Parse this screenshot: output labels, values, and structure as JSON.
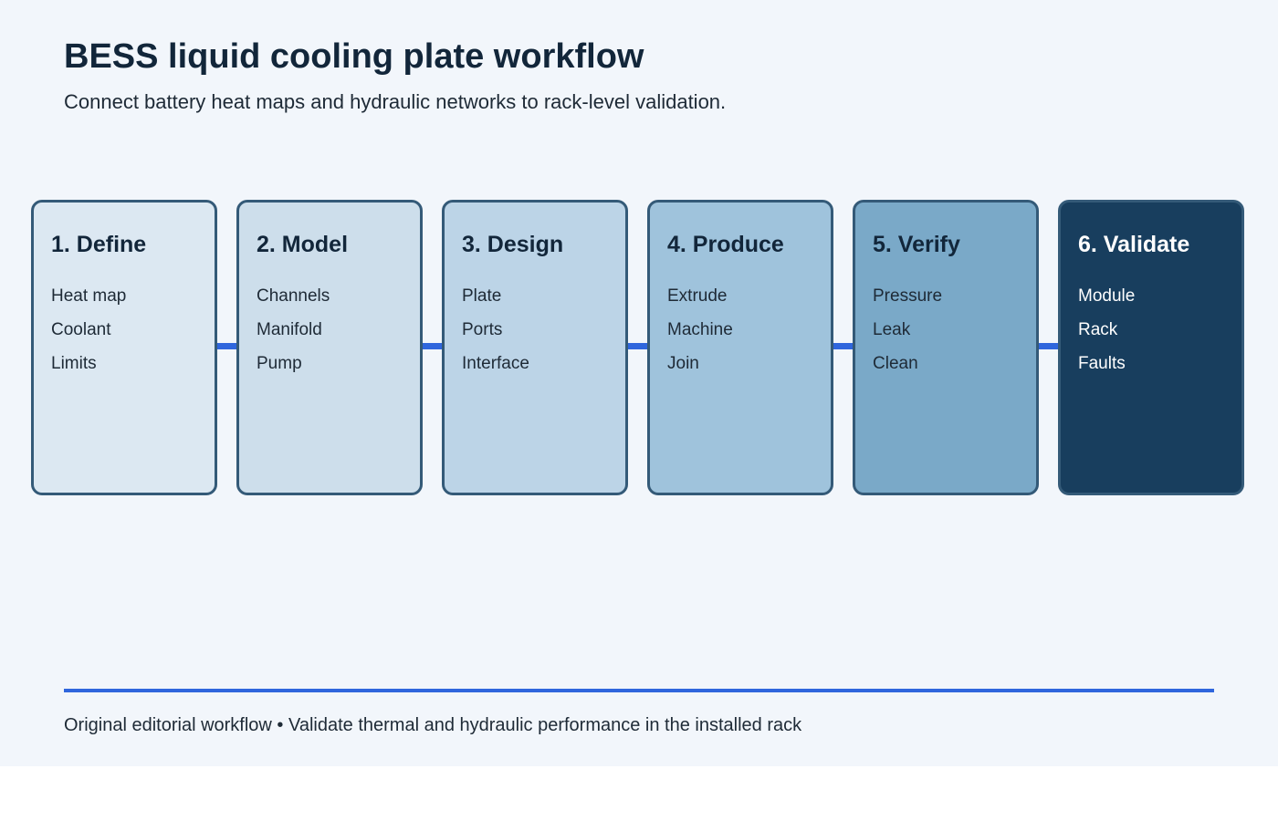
{
  "title": "BESS liquid cooling plate workflow",
  "subtitle": "Connect battery heat maps and hydraulic networks to rack-level validation.",
  "steps": [
    {
      "title": "1. Define",
      "items": [
        "Heat map",
        "Coolant",
        "Limits"
      ],
      "fill": "#dce8f2"
    },
    {
      "title": "2. Model",
      "items": [
        "Channels",
        "Manifold",
        "Pump"
      ],
      "fill": "#cddeeb"
    },
    {
      "title": "3. Design",
      "items": [
        "Plate",
        "Ports",
        "Interface"
      ],
      "fill": "#bcd4e7"
    },
    {
      "title": "4. Produce",
      "items": [
        "Extrude",
        "Machine",
        "Join"
      ],
      "fill": "#9fc3dc"
    },
    {
      "title": "5. Verify",
      "items": [
        "Pressure",
        "Leak",
        "Clean"
      ],
      "fill": "#7aa9c8"
    },
    {
      "title": "6. Validate",
      "items": [
        "Module",
        "Rack",
        "Faults"
      ],
      "fill": "#183e5e"
    }
  ],
  "footer": "Original editorial workflow • Validate thermal and hydraulic performance in the installed rack",
  "colors": {
    "background": "#f2f6fb",
    "border": "#345a78",
    "connector": "#2f66dd",
    "heading": "#12263a"
  }
}
